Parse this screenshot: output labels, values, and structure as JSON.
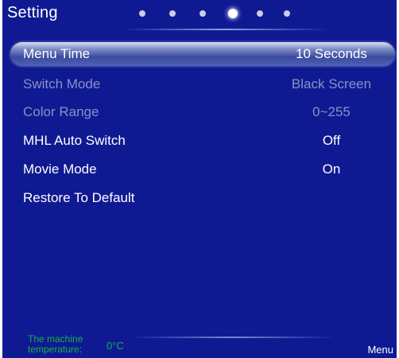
{
  "header": {
    "title": "Setting",
    "page_count": 6,
    "active_page": 4
  },
  "menu": {
    "items": [
      {
        "label": "Menu Time",
        "value": "10 Seconds",
        "state": "selected"
      },
      {
        "label": "Switch Mode",
        "value": "Black Screen",
        "state": "disabled"
      },
      {
        "label": "Color Range",
        "value": "0~255",
        "state": "disabled"
      },
      {
        "label": "MHL Auto Switch",
        "value": "Off",
        "state": "normal"
      },
      {
        "label": "Movie Mode",
        "value": "On",
        "state": "normal"
      },
      {
        "label": "Restore To Default",
        "value": "",
        "state": "normal"
      }
    ]
  },
  "footer": {
    "temperature_label": "The machine temperature:",
    "temperature_value": "0°C",
    "menu_hint": "Menu"
  },
  "colors": {
    "background": "#0f1a92",
    "text": "#ffffff",
    "disabled_text": "#8a91c4",
    "temperature_text": "#17b04a"
  }
}
